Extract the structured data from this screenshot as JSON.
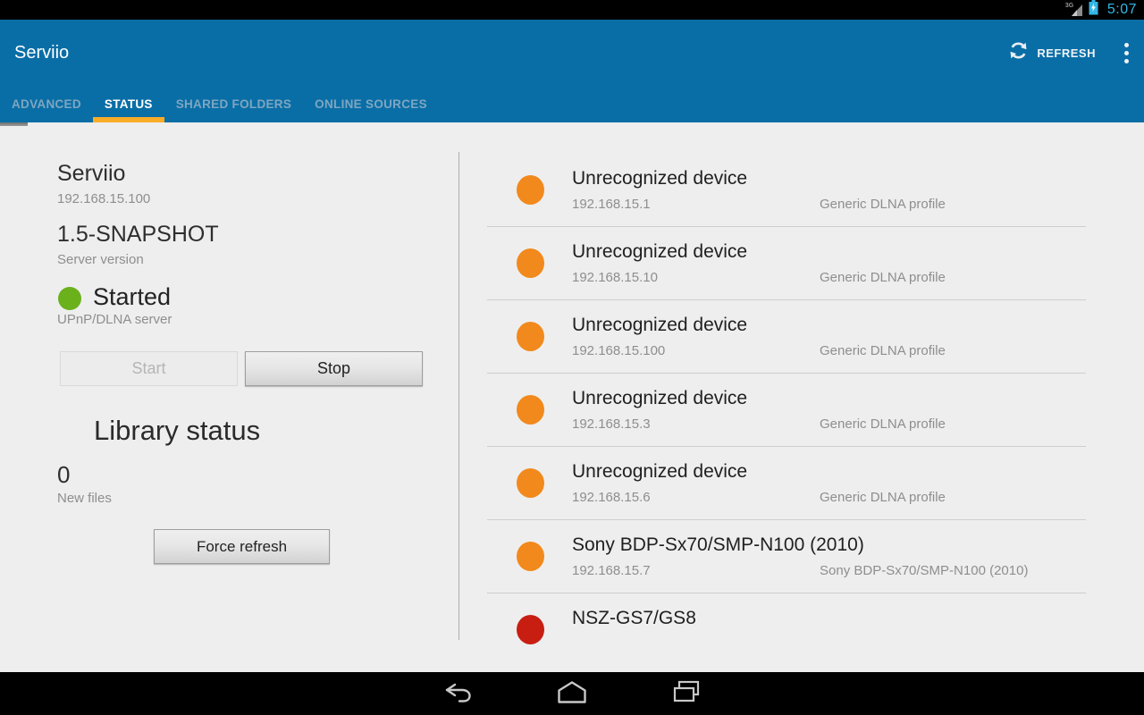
{
  "status_bar": {
    "network_label": "3G",
    "time": "5:07"
  },
  "action_bar": {
    "title": "Serviio",
    "refresh_label": "REFRESH"
  },
  "tabs": [
    {
      "label": "ADVANCED",
      "selected": false
    },
    {
      "label": "STATUS",
      "selected": true
    },
    {
      "label": "SHARED FOLDERS",
      "selected": false
    },
    {
      "label": "ONLINE SOURCES",
      "selected": false
    }
  ],
  "server": {
    "name": "Serviio",
    "address": "192.168.15.100",
    "version": "1.5-SNAPSHOT",
    "version_label": "Server version",
    "status": "Started",
    "status_label": "UPnP/DLNA server",
    "start_label": "Start",
    "stop_label": "Stop"
  },
  "library": {
    "title": "Library status",
    "new_files_count": "0",
    "new_files_label": "New files",
    "force_refresh_label": "Force refresh"
  },
  "devices": [
    {
      "name": "Unrecognized device",
      "ip": "192.168.15.1",
      "profile": "Generic DLNA profile",
      "status_color": "#f2891c"
    },
    {
      "name": "Unrecognized device",
      "ip": "192.168.15.10",
      "profile": "Generic DLNA profile",
      "status_color": "#f2891c"
    },
    {
      "name": "Unrecognized device",
      "ip": "192.168.15.100",
      "profile": "Generic DLNA profile",
      "status_color": "#f2891c"
    },
    {
      "name": "Unrecognized device",
      "ip": "192.168.15.3",
      "profile": "Generic DLNA profile",
      "status_color": "#f2891c"
    },
    {
      "name": "Unrecognized device",
      "ip": "192.168.15.6",
      "profile": "Generic DLNA profile",
      "status_color": "#f2891c"
    },
    {
      "name": "Sony BDP-Sx70/SMP-N100 (2010)",
      "ip": "192.168.15.7",
      "profile": "Sony BDP-Sx70/SMP-N100 (2010)",
      "status_color": "#f2891c"
    },
    {
      "name": "NSZ-GS7/GS8",
      "ip": "",
      "profile": "",
      "status_color": "#c81e12"
    }
  ],
  "colors": {
    "action_bar": "#0a6ea6",
    "tab_underline": "#f9ac26",
    "status_started_dot": "#6ab11c",
    "holo_blue": "#33b5e5"
  }
}
